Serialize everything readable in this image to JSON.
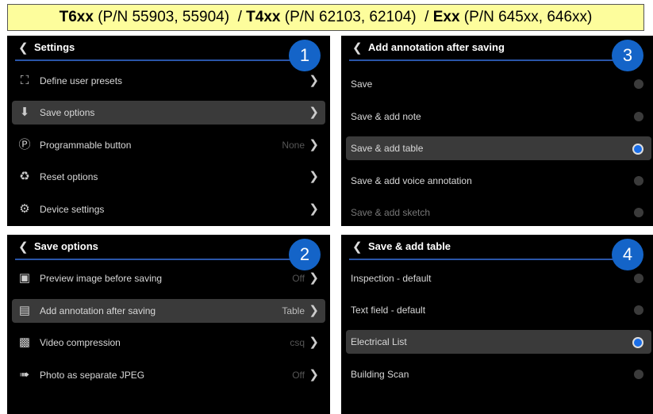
{
  "header": {
    "part1_bold": "T6xx",
    "part1_rest": " (P/N 55903, 55904)  / ",
    "part2_bold": "T4xx",
    "part2_rest": " (P/N 62103, 62104)  / ",
    "part3_bold": "Exx",
    "part3_rest": " (P/N 645xx, 646xx)"
  },
  "panel1": {
    "badge": "1",
    "title": "Settings",
    "items": [
      {
        "label": "Define user presets",
        "value": ""
      },
      {
        "label": "Save options",
        "value": ""
      },
      {
        "label": "Programmable button",
        "value": "None"
      },
      {
        "label": "Reset options",
        "value": ""
      },
      {
        "label": "Device settings",
        "value": ""
      }
    ]
  },
  "panel2": {
    "badge": "2",
    "title": "Save options",
    "items": [
      {
        "label": "Preview image before saving",
        "value": "Off"
      },
      {
        "label": "Add annotation after saving",
        "value": "Table"
      },
      {
        "label": "Video compression",
        "value": "csq"
      },
      {
        "label": "Photo as separate JPEG",
        "value": "Off"
      }
    ]
  },
  "panel3": {
    "badge": "3",
    "title": "Add annotation after saving",
    "items": [
      {
        "label": "Save"
      },
      {
        "label": "Save & add note"
      },
      {
        "label": "Save & add table"
      },
      {
        "label": "Save & add voice annotation"
      },
      {
        "label": "Save & add sketch"
      }
    ]
  },
  "panel4": {
    "badge": "4",
    "title": "Save & add table",
    "items": [
      {
        "label": "Inspection - default"
      },
      {
        "label": "Text field - default"
      },
      {
        "label": "Electrical List"
      },
      {
        "label": "Building Scan"
      }
    ]
  },
  "icons": {
    "back": "chevron-left-icon",
    "next": "chevron-right-icon",
    "presets": "frame-corners-icon",
    "save": "download-circle-icon",
    "programmable": "p-circle-icon",
    "reset": "recycle-icon",
    "device": "gear-icon",
    "preview": "image-magnifier-icon",
    "annotation": "image-plus-icon",
    "video": "checker-grid-icon",
    "photo": "export-icon"
  },
  "colors": {
    "accent": "#1464c8",
    "radio_on": "#1a6ee8",
    "title_bg": "#fdfd9c"
  }
}
